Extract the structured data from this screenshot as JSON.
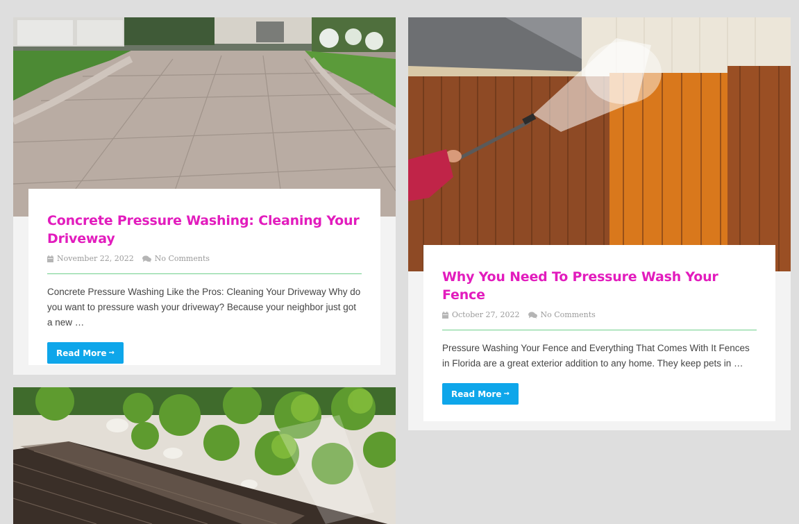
{
  "posts": [
    {
      "title": "Concrete Pressure Washing: Cleaning Your Driveway",
      "date": "November 22, 2022",
      "comments": "No Comments",
      "excerpt": "Concrete Pressure Washing Like the Pros: Cleaning Your Driveway Why do you want to pressure wash your driveway? Because your neighbor just got a new …",
      "read_more": "Read More",
      "read_more_arrow": "→"
    },
    {
      "title": "Why You Need To Pressure Wash Your Fence",
      "date": "October 27, 2022",
      "comments": "No Comments",
      "excerpt": "Pressure Washing Your Fence and Everything That Comes With It Fences in Florida are a great exterior addition to any home. They keep pets in …",
      "read_more": "Read More",
      "read_more_arrow": "→"
    }
  ],
  "icons": {
    "date": "calendar-icon",
    "comments": "comments-icon"
  },
  "colors": {
    "title": "#e21cbd",
    "button": "#0ea6ea",
    "divider": "#6fcf8b",
    "background": "#dedede"
  }
}
